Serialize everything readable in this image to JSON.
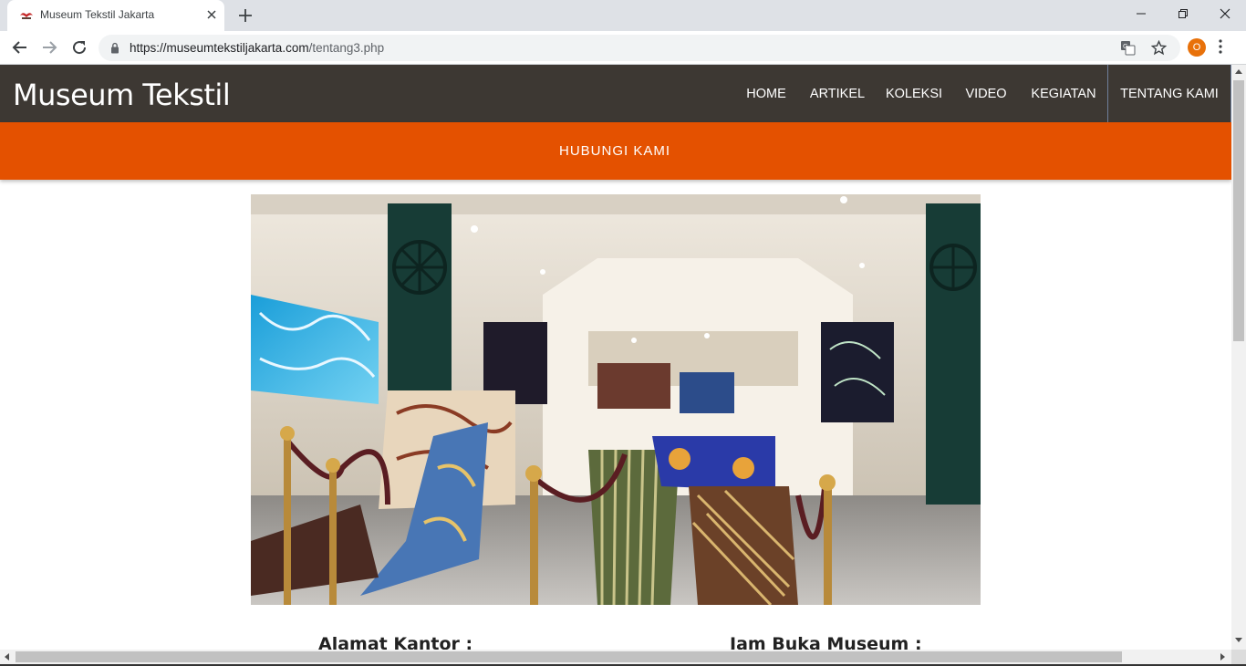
{
  "browser": {
    "tab_title": "Museum Tekstil Jakarta",
    "url_host": "https://museumtekstiljakarta.com",
    "url_path": "/tentang3.php",
    "profile_initial": "O"
  },
  "site": {
    "title": "Museum Tekstil",
    "nav": [
      "HOME",
      "ARTIKEL",
      "KOLEKSI",
      "VIDEO",
      "KEGIATAN",
      "TENTANG KAMI"
    ],
    "active_nav": "TENTANG KAMI",
    "sub_link": "HUBUNGI KAMI",
    "accent_color": "#e45100",
    "header_color": "#3d3833"
  },
  "content": {
    "address_heading": "Alamat Kantor :",
    "hours_heading": "Jam Buka Museum :"
  }
}
